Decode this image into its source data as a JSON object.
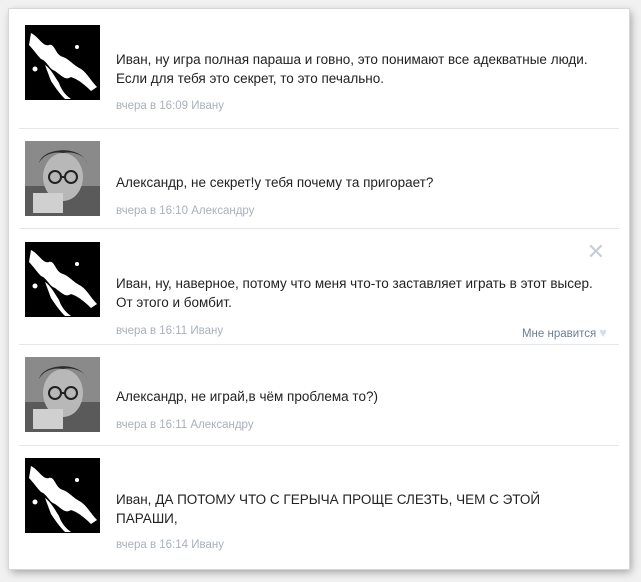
{
  "comments": [
    {
      "avatar_icon": "abstract-ink-splash-avatar",
      "text": "Иван, ну игра полная параша и говно, это понимают все адекватные люди. Если для тебя это секрет, то это печально.",
      "time": "вчера в 16:09",
      "reply_to": "Ивану"
    },
    {
      "avatar_icon": "man-with-glasses-photo-avatar",
      "text": "Александр, не секрет!у тебя почему та пригорает?",
      "time": "вчера в 16:10",
      "reply_to": "Александру"
    },
    {
      "avatar_icon": "abstract-ink-splash-avatar",
      "text": "Иван, ну, наверное, потому что меня что-то заставляет играть в этот высер. От этого и бомбит.",
      "time": "вчера в 16:11",
      "reply_to": "Ивану",
      "like_label": "Мне нравится",
      "close_icon": "close-x-icon",
      "like_icon": "heart-icon"
    },
    {
      "avatar_icon": "man-with-glasses-photo-avatar",
      "text": "Александр, не играй,в чём проблема то?)",
      "time": "вчера в 16:11",
      "reply_to": "Александру"
    },
    {
      "avatar_icon": "abstract-ink-splash-avatar",
      "text": "Иван, ДА ПОТОМУ ЧТО С ГЕРЫЧА ПРОЩЕ СЛЕЗТЬ, ЧЕМ С ЭТОЙ ПАРАШИ,",
      "time": "вчера в 16:14",
      "reply_to": "Ивану"
    }
  ],
  "colors": {
    "text": "#222222",
    "meta": "#a8b0bc",
    "like": "#6b7f98",
    "divider": "#e3e7ec"
  }
}
